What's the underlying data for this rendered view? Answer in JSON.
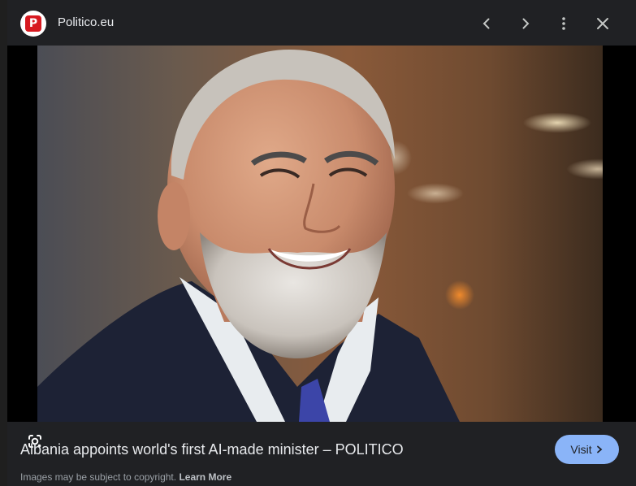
{
  "header": {
    "site_name": "Politico.eu",
    "favicon_letter": "P",
    "icons": [
      "chevron-left-icon",
      "chevron-right-icon",
      "more-vert-icon",
      "close-icon"
    ]
  },
  "colors": {
    "background": "#202124",
    "accent": "#8ab4f8",
    "favicon_red": "#d71920"
  },
  "image": {
    "lens_icon": "google-lens-icon"
  },
  "result": {
    "title": "Albania appoints world's first AI-made minister – POLITICO",
    "visit_label": "Visit"
  },
  "footer": {
    "copyright_text": "Images may be subject to copyright.",
    "learn_more": "Learn More"
  }
}
